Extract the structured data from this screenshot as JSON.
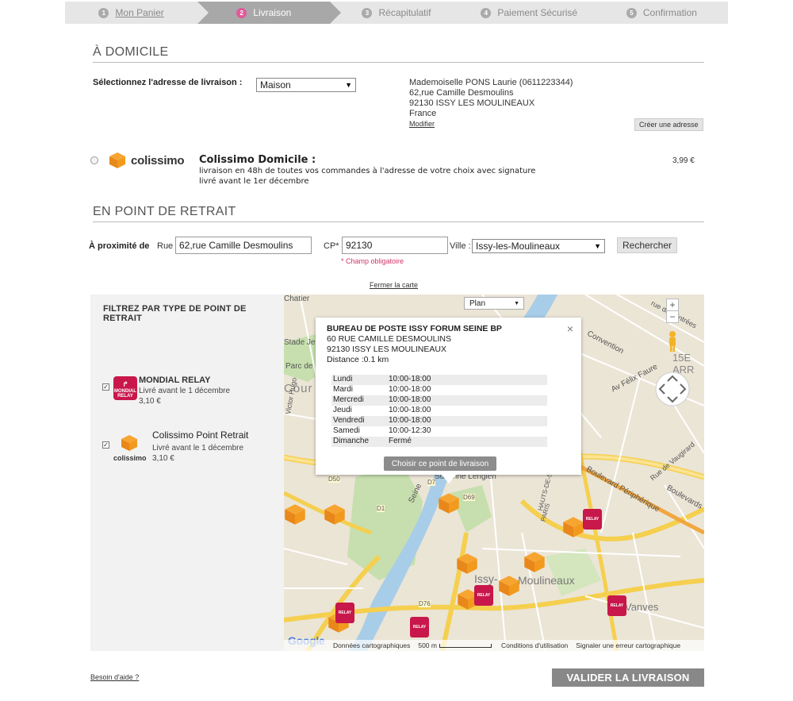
{
  "steps": [
    {
      "num": "1",
      "label": "Mon Panier"
    },
    {
      "num": "2",
      "label": "Livraison"
    },
    {
      "num": "3",
      "label": "Récapitulatif"
    },
    {
      "num": "4",
      "label": "Paiement Sécurisé"
    },
    {
      "num": "5",
      "label": "Confirmation"
    }
  ],
  "home": {
    "title": "À DOMICILE",
    "address_label": "Sélectionnez l'adresse de livraison :",
    "address_selected": "Maison",
    "address_lines": [
      "Mademoiselle PONS Laurie (0611223344)",
      "62,rue Camille Desmoulins",
      "92130 ISSY LES MOULINEAUX",
      "France"
    ],
    "modify_label": "Modifier",
    "create_label": "Créer une adresse",
    "logo_text": "colissimo",
    "option_title": "Colissimo Domicile :",
    "option_desc1": "livraison en 48h de toutes vos commandes à l'adresse de votre choix avec signature",
    "option_desc2": "livré avant le 1er décembre",
    "option_price": "3,99 €"
  },
  "relay": {
    "title": "EN POINT DE RETRAIT",
    "near_label": "À proximité de",
    "street_label": "Rue",
    "street_value": "62,rue Camille Desmoulins",
    "cp_label": "CP*",
    "cp_value": "92130",
    "required_note": "* Champ obligatoire",
    "city_label": "Ville :",
    "city_value": "Issy-les-Moulineaux",
    "search_label": "Rechercher",
    "close_map_label": "Fermer la carte"
  },
  "filter": {
    "title": "FILTREZ PAR TYPE DE POINT DE RETRAIT",
    "mondial": {
      "name": "MONDIAL RELAY",
      "delivery": "Livré avant le 1 décembre",
      "price": "3,10 €",
      "logo_top": "MONDIAL",
      "logo_bottom": "RELAY"
    },
    "colissimo": {
      "name": "Colissimo Point Retrait",
      "delivery": "Livré avant le 1 décembre",
      "price": "3,10 €",
      "logo_text": "colissimo"
    }
  },
  "map": {
    "type_select": "Plan",
    "zoom_in": "+",
    "zoom_out": "−",
    "labels": {
      "stade": "Stade Je",
      "parc": "Parc de",
      "court": "Cour",
      "victor": "Victor Hugo",
      "faure": "Av Félix Faure",
      "convention": "Convention",
      "arr": "15E ARR",
      "entrees": "rue des Entrées",
      "vaugirard": "Rue de Vaugirard",
      "periph": "Boulevard Périphérique",
      "boulevards": "Boulevards",
      "issy": "Issy-",
      "moulineaux": "Moulineaux",
      "vanves": "Vanves",
      "seine": "Seine",
      "lenglen": "Suzanne Lenglen",
      "hauts": "HAUTS-DE-SEINE",
      "paris": "PARIS",
      "chatier": "Chatier",
      "d50": "D50",
      "d7": "D7",
      "d1": "D1",
      "d69": "D69",
      "d76": "D76"
    },
    "google": "Google",
    "footer_data": "Données cartographiques",
    "footer_scale": "500 m",
    "footer_terms": "Conditions d'utilisation",
    "footer_report": "Signaler une erreur cartographique"
  },
  "popup": {
    "name": "BUREAU DE POSTE ISSY FORUM SEINE BP",
    "street": "60 RUE CAMILLE DESMOULINS",
    "city": "92130 ISSY LES MOULINEAUX",
    "distance": "Distance :0.1 km",
    "close": "×",
    "hours": [
      {
        "day": "Lundi",
        "time": "10:00-18:00"
      },
      {
        "day": "Mardi",
        "time": "10:00-18:00"
      },
      {
        "day": "Mercredi",
        "time": "10:00-18:00"
      },
      {
        "day": "Jeudi",
        "time": "10:00-18:00"
      },
      {
        "day": "Vendredi",
        "time": "10:00-18:00"
      },
      {
        "day": "Samedi",
        "time": "10:00-12:30"
      },
      {
        "day": "Dimanche",
        "time": "Fermé"
      }
    ],
    "choose_label": "Choisir ce point de livraison"
  },
  "footer": {
    "help": "Besoin d'aide ?",
    "validate": "VALIDER LA LIVRAISON"
  }
}
